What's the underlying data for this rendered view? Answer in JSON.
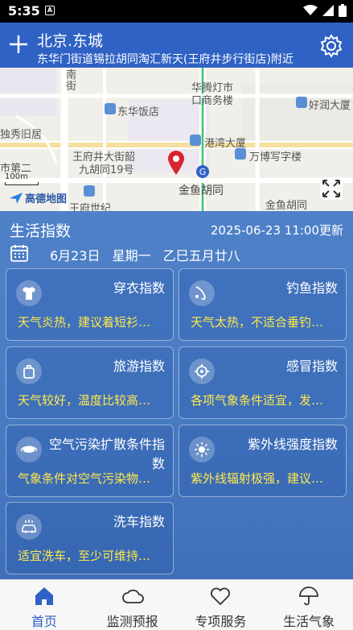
{
  "status": {
    "time": "5:35",
    "app_badge": "A"
  },
  "header": {
    "city": "北京.东城",
    "address": "东华门街道锡拉胡同淘汇新天(王府井步行街店)附近"
  },
  "map": {
    "labels": [
      "南",
      "街",
      "华腾灯市",
      "口商务楼",
      "好润大厦",
      "东华饭店",
      "独秀旧居",
      "港湾大厦",
      "万博写字楼",
      "市第二",
      "王府井大街韶",
      "九胡同19号",
      "金鱼胡同",
      "王府世纪",
      "金鱼胡同"
    ],
    "scale": "100m",
    "provider": "高德地图"
  },
  "panel": {
    "title": "生活指数",
    "updated": "2025-06-23 11:00更新",
    "date": "6月23日",
    "weekday": "星期一",
    "lunar": "乙巳五月廿八"
  },
  "cards": [
    {
      "name": "穿衣指数",
      "desc": "天气炎热，建议着短衫…",
      "icon": "shirt-icon"
    },
    {
      "name": "钓鱼指数",
      "desc": "天气太热，不适合垂钓…",
      "icon": "fishing-icon"
    },
    {
      "name": "旅游指数",
      "desc": "天气较好，温度比较高…",
      "icon": "travel-icon"
    },
    {
      "name": "感冒指数",
      "desc": "各项气象条件适宜，发…",
      "icon": "virus-icon"
    },
    {
      "name": "空气污染扩散条件指数",
      "desc": "气象条件对空气污染物…",
      "icon": "mask-icon"
    },
    {
      "name": "紫外线强度指数",
      "desc": "紫外线辐射极强，建议…",
      "icon": "sun-icon"
    },
    {
      "name": "洗车指数",
      "desc": "适宜洗车，至少可维持…",
      "icon": "car-wash-icon"
    }
  ],
  "nav": [
    {
      "label": "首页",
      "icon": "home-icon"
    },
    {
      "label": "监测预报",
      "icon": "cloud-icon"
    },
    {
      "label": "专项服务",
      "icon": "heart-icon"
    },
    {
      "label": "生活气象",
      "icon": "umbrella-icon"
    }
  ],
  "colors": {
    "header": "#2f62c4",
    "panel": "#4a7cc4",
    "accent_text": "#ffe94d",
    "active_nav": "#2f62c4"
  }
}
